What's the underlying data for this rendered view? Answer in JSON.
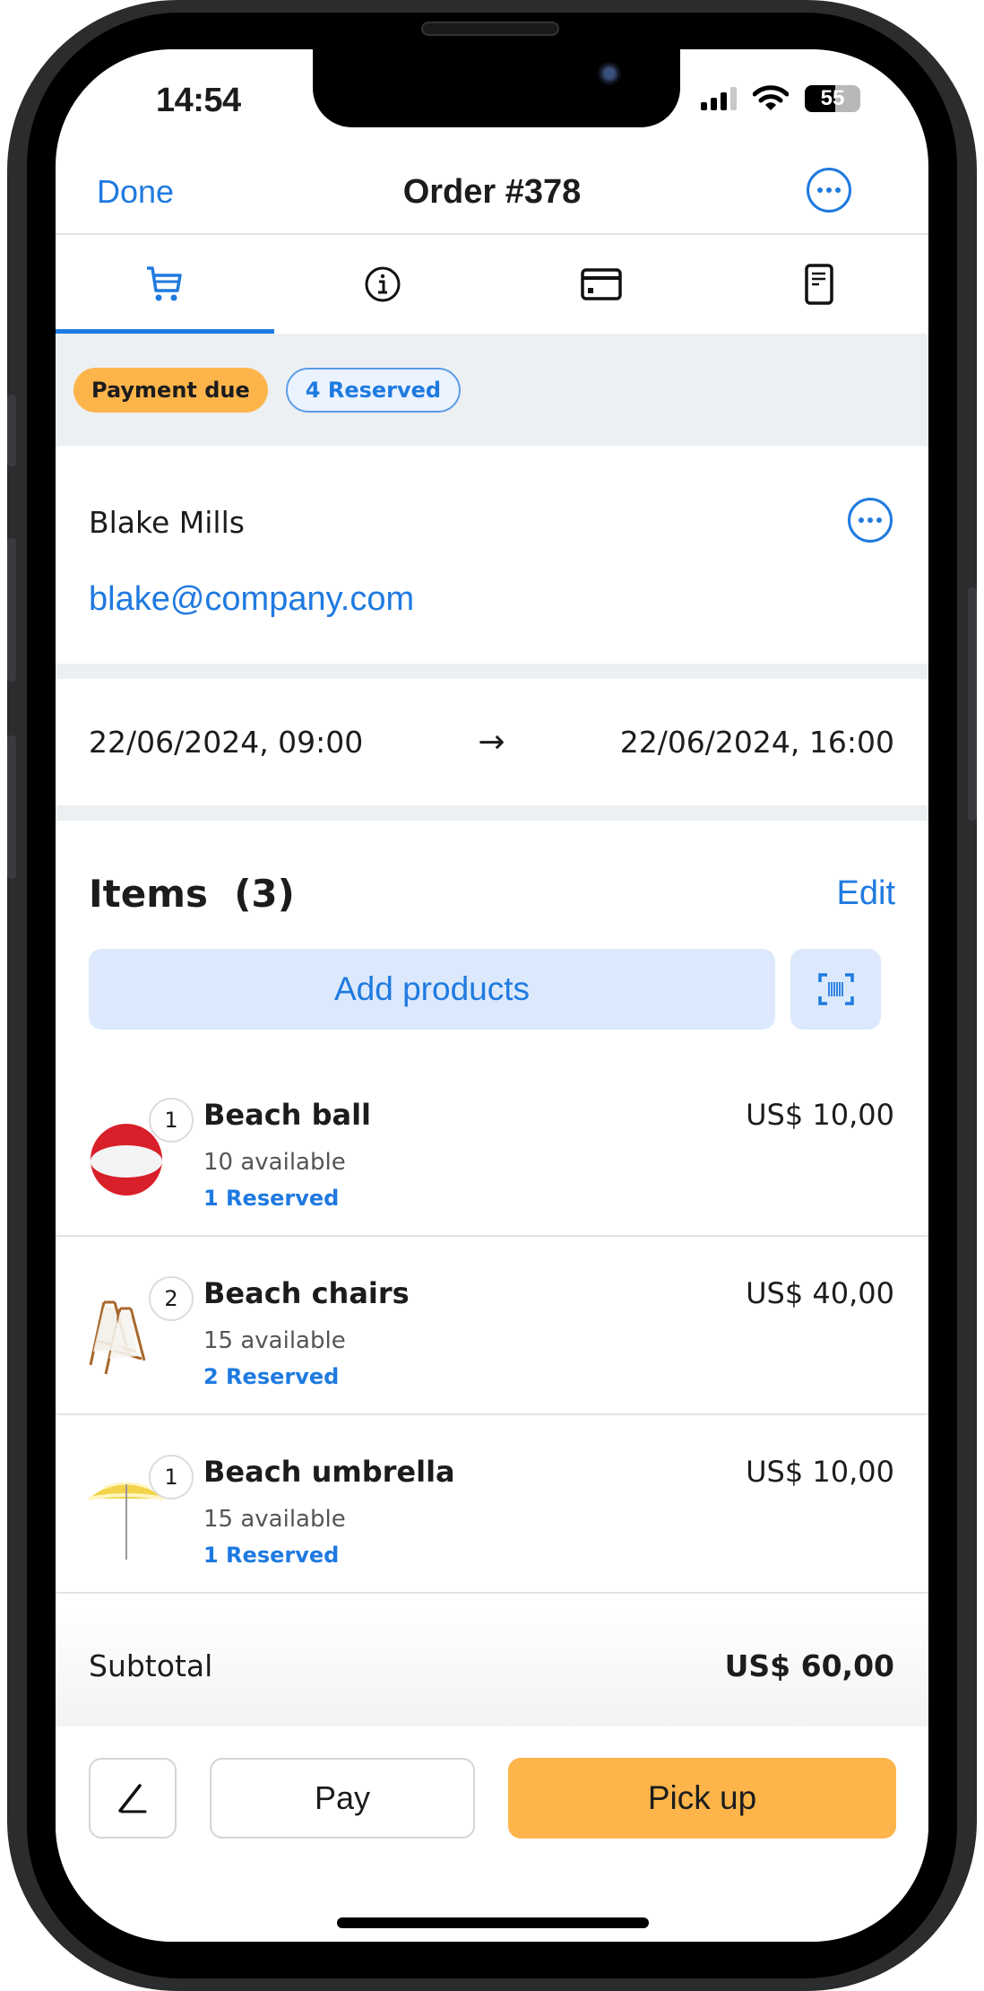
{
  "status_bar": {
    "time": "14:54",
    "battery": "55",
    "battery_level_percent": 55,
    "signal_bars_active": 3,
    "signal_bars_total": 4
  },
  "navbar": {
    "done_label": "Done",
    "title": "Order #378",
    "more_icon": "ellipsis-circle-icon"
  },
  "tabs": [
    {
      "icon": "cart-icon",
      "active": true
    },
    {
      "icon": "info-icon",
      "active": false
    },
    {
      "icon": "credit-card-icon",
      "active": false
    },
    {
      "icon": "receipt-icon",
      "active": false
    }
  ],
  "badges": {
    "payment": "Payment due",
    "reserved": "4 Reserved"
  },
  "customer": {
    "name": "Blake Mills",
    "email": "blake@company.com"
  },
  "dates": {
    "start": "22/06/2024, 09:00",
    "arrow": "→",
    "end": "22/06/2024, 16:00"
  },
  "items_section": {
    "title": "Items  (3)",
    "edit_label": "Edit",
    "add_products_label": "Add products",
    "scan_icon": "barcode-scan-icon"
  },
  "items": [
    {
      "qty": "1",
      "name": "Beach ball",
      "available": "10 available",
      "reserved": "1 Reserved",
      "price": "US$ 10,00",
      "image": "beach-ball"
    },
    {
      "qty": "2",
      "name": "Beach chairs",
      "available": "15 available",
      "reserved": "2 Reserved",
      "price": "US$ 40,00",
      "image": "beach-chairs"
    },
    {
      "qty": "1",
      "name": "Beach umbrella",
      "available": "15 available",
      "reserved": "1 Reserved",
      "price": "US$ 10,00",
      "image": "beach-umbrella"
    }
  ],
  "subtotal": {
    "label": "Subtotal",
    "value": "US$ 60,00"
  },
  "footer": {
    "edit_icon": "pencil-icon",
    "pay_label": "Pay",
    "pickup_label": "Pick up"
  },
  "colors": {
    "accent": "#1f7ae0",
    "warning": "#fdb44a",
    "section_bg": "#edf0f2"
  }
}
